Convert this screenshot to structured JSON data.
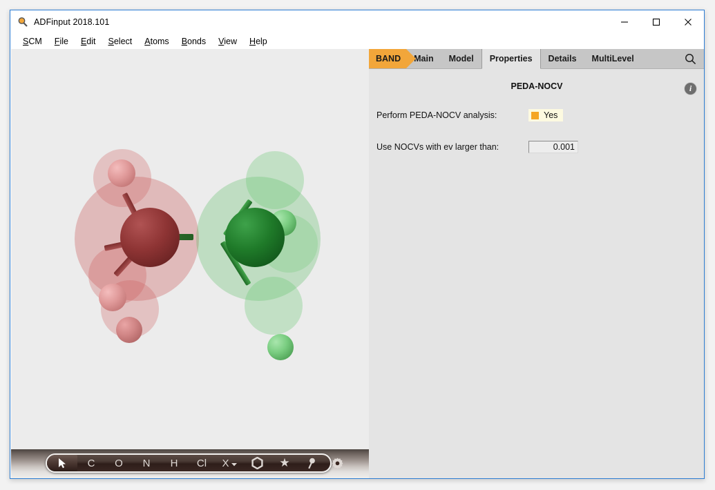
{
  "window": {
    "title": "ADFinput 2018.101",
    "app_icon": "magnifier-icon",
    "minimize_label": "—",
    "maximize_label": "□",
    "close_label": "✕",
    "border_color": "#2b7cd3"
  },
  "menubar": {
    "items": [
      {
        "mnemonic": "S",
        "rest": "CM"
      },
      {
        "mnemonic": "F",
        "rest": "ile"
      },
      {
        "mnemonic": "E",
        "rest": "dit"
      },
      {
        "mnemonic": "S",
        "rest": "elect"
      },
      {
        "mnemonic": "A",
        "rest": "toms"
      },
      {
        "mnemonic": "B",
        "rest": "onds"
      },
      {
        "mnemonic": "V",
        "rest": "iew"
      },
      {
        "mnemonic": "H",
        "rest": "elp"
      }
    ]
  },
  "tabs": {
    "program_label": "BAND",
    "program_color": "#f2a63a",
    "items": [
      {
        "label": "Main",
        "selected": false
      },
      {
        "label": "Model",
        "selected": false
      },
      {
        "label": "Properties",
        "selected": true
      },
      {
        "label": "Details",
        "selected": false
      },
      {
        "label": "MultiLevel",
        "selected": false
      }
    ],
    "search_icon": "search-icon"
  },
  "panel": {
    "section_title": "PEDA-NOCV",
    "info_icon": "info-icon",
    "info_glyph": "i",
    "fields": [
      {
        "label": "Perform PEDA-NOCV analysis:",
        "type": "checkbox",
        "value": "Yes",
        "checked": true,
        "accent": "#f5a623",
        "field_bg": "#fdfae0"
      },
      {
        "label": "Use NOCVs with ev larger than:",
        "type": "number",
        "value": "0.001"
      }
    ]
  },
  "viewport": {
    "background": "#ececec",
    "molecule_name": "ethane-peda-fragments",
    "fragments": [
      {
        "name": "fragment-left",
        "color": "#8c3030",
        "cloud_color": "rgba(196,72,72,0.30)"
      },
      {
        "name": "fragment-right",
        "color": "#1d7a28",
        "cloud_color": "rgba(60,175,70,0.30)"
      }
    ]
  },
  "toolbar": {
    "selected_tool": "select-arrow",
    "tools": [
      {
        "name": "select-arrow-tool",
        "glyph": "➤",
        "selected": true
      },
      {
        "name": "carbon-tool",
        "glyph": "C",
        "selected": false
      },
      {
        "name": "oxygen-tool",
        "glyph": "O",
        "selected": false
      },
      {
        "name": "nitrogen-tool",
        "glyph": "N",
        "selected": false
      },
      {
        "name": "hydrogen-tool",
        "glyph": "H",
        "selected": false
      },
      {
        "name": "chlorine-tool",
        "glyph": "Cl",
        "selected": false
      },
      {
        "name": "other-element-tool",
        "glyph": "X",
        "selected": false,
        "has_dropdown": true
      },
      {
        "name": "ring-tool",
        "glyph": "⬡",
        "selected": false
      }
    ],
    "right_tools": [
      {
        "name": "star-tool",
        "glyph": "★"
      },
      {
        "name": "pin-tool",
        "glyph": "⚲"
      },
      {
        "name": "gear-tool",
        "glyph": "⚙"
      }
    ]
  }
}
